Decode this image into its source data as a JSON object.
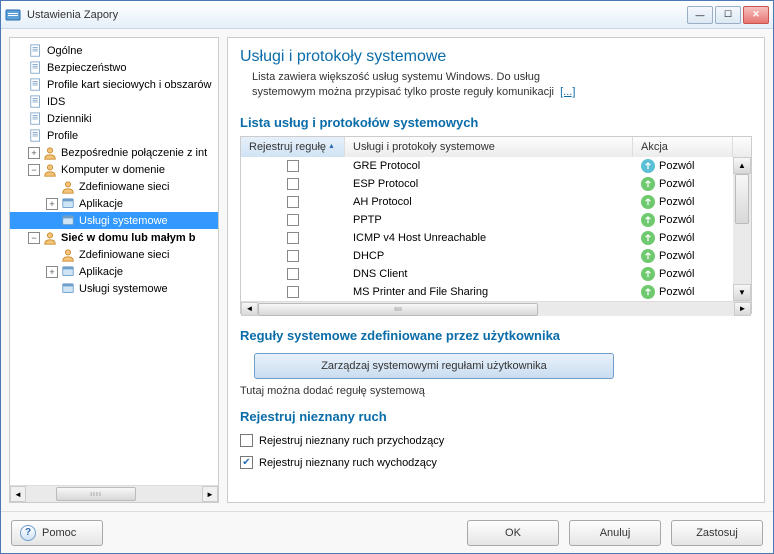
{
  "window": {
    "title": "Ustawienia Zapory"
  },
  "tree": [
    {
      "label": "Ogólne",
      "indent": 0,
      "icon": "doc",
      "exp": ""
    },
    {
      "label": "Bezpieczeństwo",
      "indent": 0,
      "icon": "doc",
      "exp": ""
    },
    {
      "label": "Profile kart sieciowych i obszarów",
      "indent": 0,
      "icon": "doc",
      "exp": ""
    },
    {
      "label": "IDS",
      "indent": 0,
      "icon": "doc",
      "exp": ""
    },
    {
      "label": "Dzienniki",
      "indent": 0,
      "icon": "doc",
      "exp": ""
    },
    {
      "label": "Profile",
      "indent": 0,
      "icon": "doc",
      "exp": ""
    },
    {
      "label": "Bezpośrednie połączenie z int",
      "indent": 1,
      "icon": "user",
      "exp": "+"
    },
    {
      "label": "Komputer w domenie",
      "indent": 1,
      "icon": "user",
      "exp": "−"
    },
    {
      "label": "Zdefiniowane sieci",
      "indent": 2,
      "icon": "net",
      "exp": ""
    },
    {
      "label": "Aplikacje",
      "indent": 2,
      "icon": "app",
      "exp": "+"
    },
    {
      "label": "Usługi systemowe",
      "indent": 2,
      "icon": "sys",
      "exp": "",
      "selected": true
    },
    {
      "label": "Sieć w domu lub małym b",
      "indent": 1,
      "icon": "user",
      "exp": "−",
      "bold": true
    },
    {
      "label": "Zdefiniowane sieci",
      "indent": 2,
      "icon": "net",
      "exp": ""
    },
    {
      "label": "Aplikacje",
      "indent": 2,
      "icon": "app",
      "exp": "+"
    },
    {
      "label": "Usługi systemowe",
      "indent": 2,
      "icon": "sys",
      "exp": ""
    }
  ],
  "main": {
    "title": "Usługi i protokoły systemowe",
    "desc_line1": "Lista zawiera większość usług systemu Windows. Do usług",
    "desc_line2": "systemowym można przypisać tylko proste reguły komunikacji",
    "more": "[...]",
    "list_title": "Lista usług i protokołów systemowych",
    "columns": {
      "reg": "Rejestruj regułę",
      "name": "Usługi i protokoły systemowe",
      "action": "Akcja"
    },
    "rows": [
      {
        "name": "GRE Protocol",
        "action": "Pozwól",
        "icon": "g2"
      },
      {
        "name": "ESP Protocol",
        "action": "Pozwól",
        "icon": "g"
      },
      {
        "name": "AH Protocol",
        "action": "Pozwól",
        "icon": "g"
      },
      {
        "name": "PPTP",
        "action": "Pozwól",
        "icon": "g"
      },
      {
        "name": "ICMP v4 Host Unreachable",
        "action": "Pozwól",
        "icon": "g"
      },
      {
        "name": "DHCP",
        "action": "Pozwól",
        "icon": "g"
      },
      {
        "name": "DNS Client",
        "action": "Pozwól",
        "icon": "g"
      },
      {
        "name": "MS Printer and File Sharing",
        "action": "Pozwól",
        "icon": "g"
      }
    ],
    "user_rules_title": "Reguły systemowe zdefiniowane przez użytkownika",
    "manage_button": "Zarządzaj systemowymi regułami użytkownika",
    "user_rules_hint": "Tutaj można dodać regułę systemową",
    "log_title": "Rejestruj nieznany ruch",
    "log_incoming": "Rejestruj nieznany ruch przychodzący",
    "log_outgoing": "Rejestruj nieznany ruch wychodzący"
  },
  "footer": {
    "help": "Pomoc",
    "ok": "OK",
    "cancel": "Anuluj",
    "apply": "Zastosuj"
  }
}
